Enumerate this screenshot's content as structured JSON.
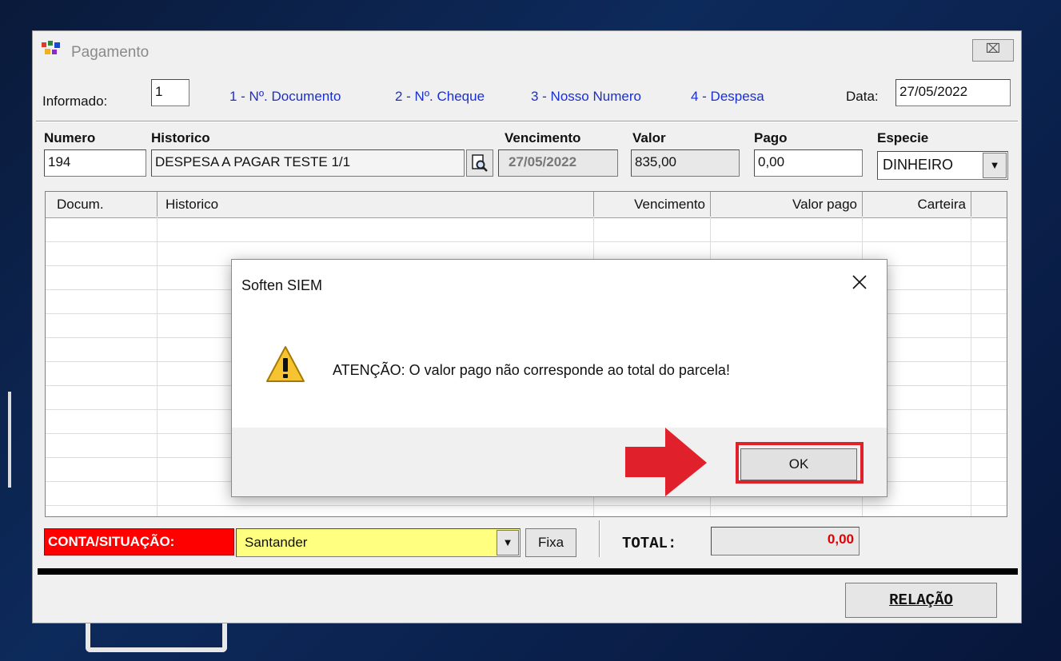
{
  "window": {
    "title": "Pagamento",
    "close_glyph": "⌧"
  },
  "filter": {
    "informado_label": "Informado:",
    "informado_value": "1",
    "options": [
      "1 - Nº. Documento",
      "2 - Nº. Cheque",
      "3 - Nosso Numero",
      "4 - Despesa"
    ],
    "data_label": "Data:",
    "data_value": "27/05/2022"
  },
  "entry": {
    "numero_label": "Numero",
    "numero_value": "194",
    "historico_label": "Historico",
    "historico_value": "DESPESA A PAGAR TESTE 1/1",
    "vencimento_label": "Vencimento",
    "vencimento_value": "27/05/2022",
    "valor_label": "Valor",
    "valor_value": "835,00",
    "pago_label": "Pago",
    "pago_value": "0,00",
    "especie_label": "Especie",
    "especie_value": "DINHEIRO"
  },
  "grid": {
    "columns": [
      "Docum.",
      "Historico",
      "Vencimento",
      "Valor pago",
      "Carteira"
    ]
  },
  "footer": {
    "conta_label": "CONTA/SITUAÇÃO:",
    "conta_value": "Santander",
    "fixa_label": "Fixa",
    "total_label": "TOTAL:",
    "total_value": "0,00",
    "relacao_label": "RELAÇÃO"
  },
  "dialog": {
    "title": "Soften SIEM",
    "message": "ATENÇÃO: O valor pago não corresponde ao total do parcela!",
    "ok_label": "OK"
  },
  "colors": {
    "link_blue": "#1a2fd0",
    "conta_red": "#ff0000",
    "conta_yellow": "#ffff80",
    "highlight_red": "#e0202a",
    "total_red": "#e00000"
  }
}
